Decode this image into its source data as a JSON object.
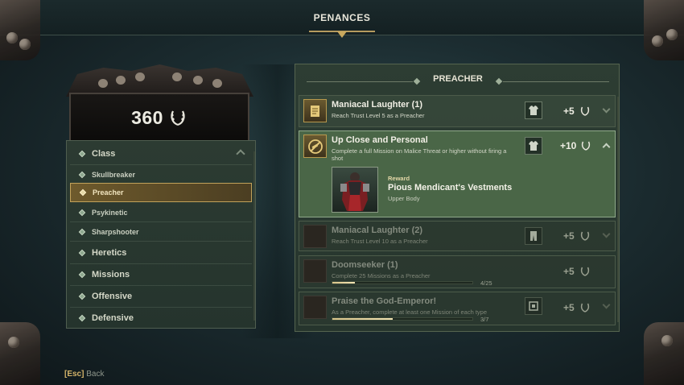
{
  "top": {
    "title": "PENANCES"
  },
  "score": {
    "value": "360"
  },
  "menu": {
    "items": [
      {
        "label": "Class",
        "kind": "header",
        "expanded": true
      },
      {
        "label": "Skullbreaker",
        "kind": "sub"
      },
      {
        "label": "Preacher",
        "kind": "sub",
        "selected": true
      },
      {
        "label": "Psykinetic",
        "kind": "sub"
      },
      {
        "label": "Sharpshooter",
        "kind": "sub"
      },
      {
        "label": "Heretics",
        "kind": "header"
      },
      {
        "label": "Missions",
        "kind": "header"
      },
      {
        "label": "Offensive",
        "kind": "header"
      },
      {
        "label": "Defensive",
        "kind": "header"
      }
    ]
  },
  "panel": {
    "title": "PREACHER",
    "cards": [
      {
        "title": "Maniacal Laughter (1)",
        "desc": "Reach Trust Level 5 as a Preacher",
        "points": "+5",
        "reward_icon": "upper-body-icon",
        "state": "completed"
      },
      {
        "title": "Up Close and Personal",
        "desc": "Complete a full Mission on Malice Threat or higher without firing a shot",
        "points": "+10",
        "reward_icon": "upper-body-icon",
        "state": "expanded",
        "reward": {
          "label": "Reward",
          "name": "Pious Mendicant's Vestments",
          "type": "Upper Body"
        }
      },
      {
        "title": "Maniacal Laughter (2)",
        "desc": "Reach Trust Level 10 as a Preacher",
        "points": "+5",
        "reward_icon": "lower-body-icon",
        "state": "locked"
      },
      {
        "title": "Doomseeker (1)",
        "desc": "Complete 25 Missions as a Preacher",
        "points": "+5",
        "state": "locked",
        "progress_text": "4/25",
        "progress": 0.16
      },
      {
        "title": "Praise the God-Emperor!",
        "desc": "As a Preacher, complete at least one Mission of each type",
        "points": "+5",
        "reward_icon": "frame-icon",
        "state": "locked",
        "progress_text": "3/7",
        "progress": 0.43
      }
    ]
  },
  "footer": {
    "key": "[Esc]",
    "label": "Back"
  },
  "colors": {
    "accent_gold": "#c2a25a",
    "panel_green": "#2d3d33",
    "selected_green": "#4a6647"
  }
}
